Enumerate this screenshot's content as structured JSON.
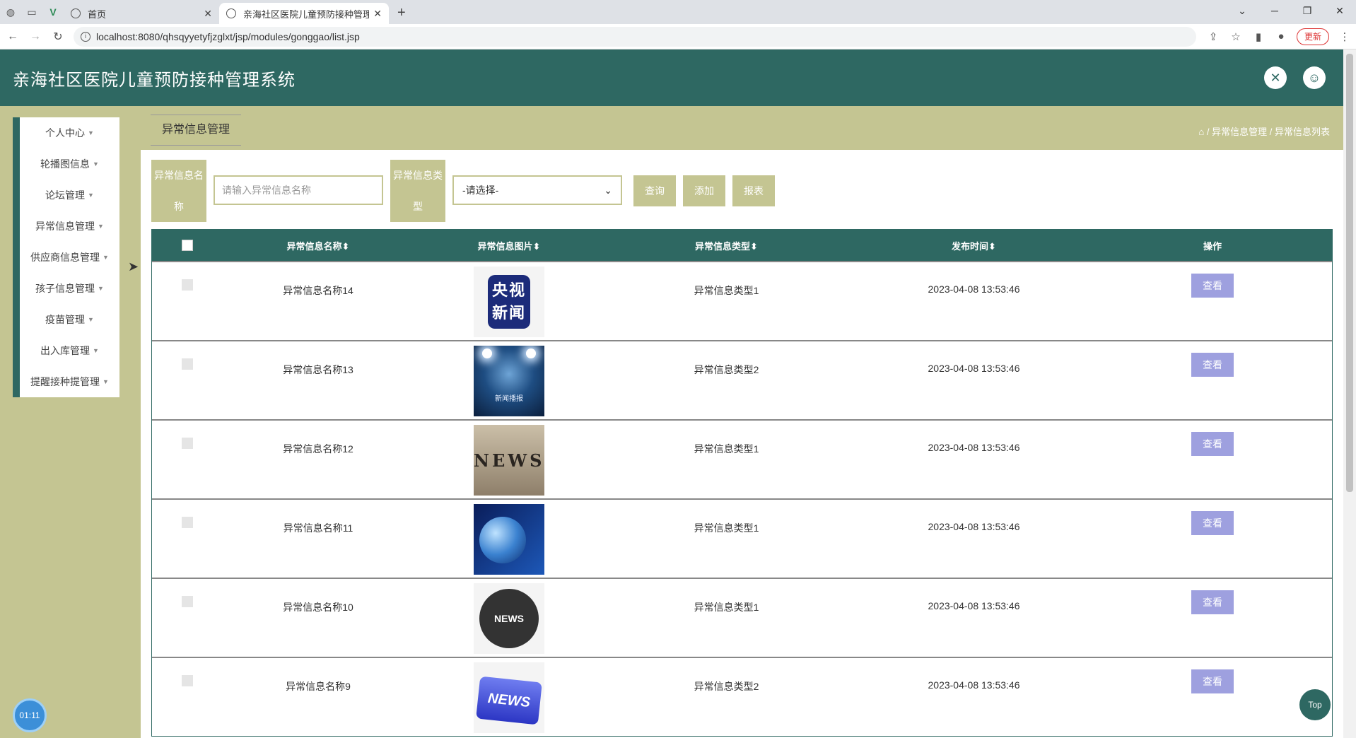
{
  "browser": {
    "tabs": [
      {
        "label": "首页"
      },
      {
        "label": "亲海社区医院儿童预防接种管理系"
      }
    ],
    "new_tab": "+",
    "url": "localhost:8080/qhsqyyetyfjzglxt/jsp/modules/gonggao/list.jsp",
    "update_label": "更新"
  },
  "header": {
    "title": "亲海社区医院儿童预防接种管理系统"
  },
  "sidebar": {
    "items": [
      {
        "label": "个人中心"
      },
      {
        "label": "轮播图信息"
      },
      {
        "label": "论坛管理"
      },
      {
        "label": "异常信息管理"
      },
      {
        "label": "供应商信息管理"
      },
      {
        "label": "孩子信息管理"
      },
      {
        "label": "疫苗管理"
      },
      {
        "label": "出入库管理"
      },
      {
        "label": "提醒接种提管理"
      }
    ]
  },
  "page": {
    "tab_title": "异常信息管理",
    "breadcrumb": {
      "sep": "/",
      "level1": "异常信息管理",
      "level2": "异常信息列表"
    }
  },
  "filter": {
    "name_label": "异常信息名称",
    "name_placeholder": "请输入异常信息名称",
    "type_label": "异常信息类型",
    "type_selected": "-请选择-",
    "query_label": "查询",
    "add_label": "添加",
    "report_label": "报表"
  },
  "table": {
    "headers": [
      "异常信息名称",
      "异常信息图片",
      "异常信息类型",
      "发布时间",
      "操作"
    ],
    "sort_icon": "⬍",
    "view_label": "查看",
    "rows": [
      {
        "name": "异常信息名称14",
        "type": "异常信息类型1",
        "time": "2023-04-08 13:53:46",
        "image": "cctv-news"
      },
      {
        "name": "异常信息名称13",
        "type": "异常信息类型2",
        "time": "2023-04-08 13:53:46",
        "image": "stage-spotlight"
      },
      {
        "name": "异常信息名称12",
        "type": "异常信息类型1",
        "time": "2023-04-08 13:53:46",
        "image": "news-dice"
      },
      {
        "name": "异常信息名称11",
        "type": "异常信息类型1",
        "time": "2023-04-08 13:53:46",
        "image": "globe-blue"
      },
      {
        "name": "异常信息名称10",
        "type": "异常信息类型1",
        "time": "2023-04-08 13:53:46",
        "image": "news-globe-badge"
      },
      {
        "name": "异常信息名称9",
        "type": "异常信息类型2",
        "time": "2023-04-08 13:53:46",
        "image": "news-key"
      }
    ]
  },
  "images": {
    "cctv_text": "央视新闻",
    "stage_text": "新闻播报",
    "news_text": "NEWS"
  },
  "timer": "01:11",
  "top_label": "Top",
  "colors": {
    "primary": "#2e6862",
    "accent": "#c4c592",
    "view_button": "#9ea0df"
  }
}
